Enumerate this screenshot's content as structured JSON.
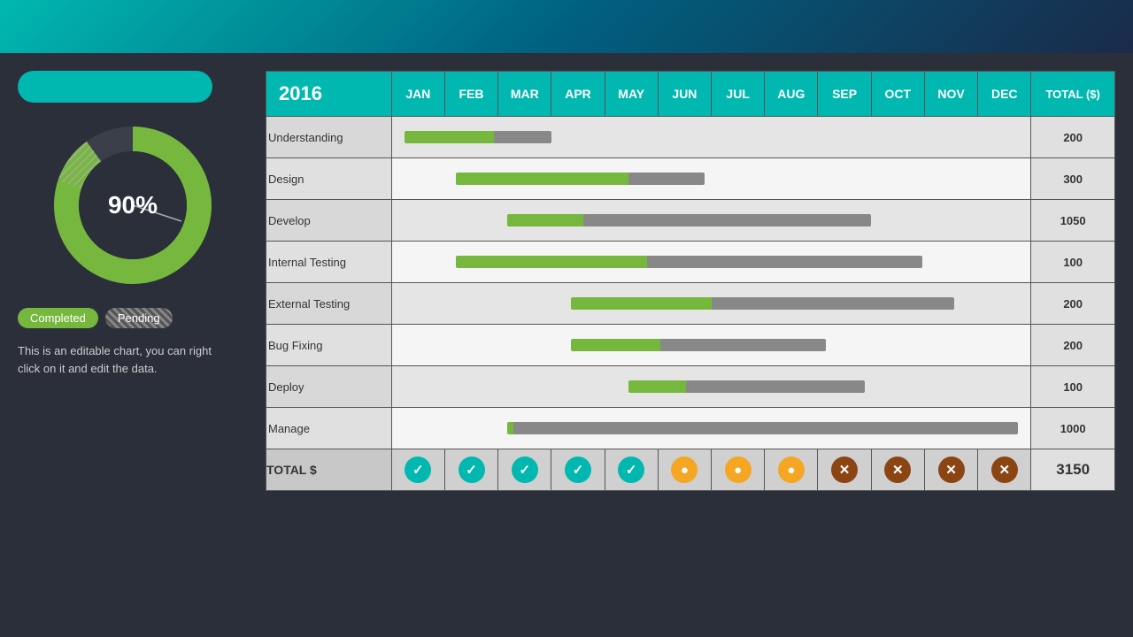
{
  "header": {
    "title_bar_placeholder": ""
  },
  "left": {
    "percentage": "90%",
    "legend_completed": "Completed",
    "legend_pending": "Pending",
    "description": "This is an editable chart, you can right click on it and edit the data."
  },
  "chart": {
    "year": "2016",
    "months": [
      "JAN",
      "FEB",
      "MAR",
      "APR",
      "MAY",
      "JUN",
      "JUL",
      "AUG",
      "SEP",
      "OCT",
      "NOV",
      "DEC"
    ],
    "total_header": "TOTAL ($)",
    "rows": [
      {
        "label": "Understanding",
        "total": "200"
      },
      {
        "label": "Design",
        "total": "300"
      },
      {
        "label": "Develop",
        "total": "1050"
      },
      {
        "label": "Internal Testing",
        "total": "100"
      },
      {
        "label": "External Testing",
        "total": "200"
      },
      {
        "label": "Bug Fixing",
        "total": "200"
      },
      {
        "label": "Deploy",
        "total": "100"
      },
      {
        "label": "Manage",
        "total": "1000"
      }
    ],
    "total_row_label": "TOTAL $",
    "total_row_value": "3150",
    "month_statuses": [
      "check",
      "check",
      "check",
      "check",
      "check",
      "circle",
      "circle",
      "circle",
      "x",
      "x",
      "x",
      "x"
    ]
  },
  "donut": {
    "percentage": 90,
    "completed_color": "#76b83e",
    "pending_color": "#888",
    "track_color": "#3a3f4a"
  }
}
